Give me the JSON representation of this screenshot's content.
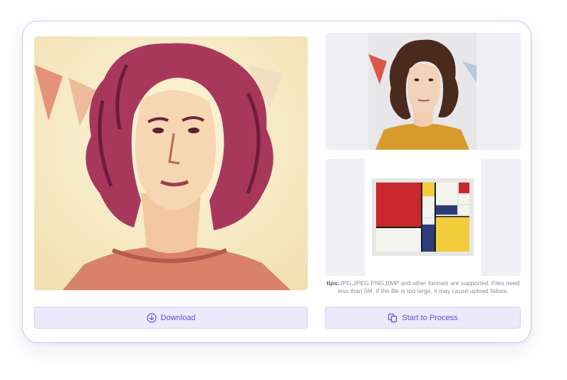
{
  "result": {
    "image_icon": "stylized-portrait-image"
  },
  "original": {
    "image_icon": "portrait-photo"
  },
  "style_reference": {
    "image_icon": "abstract-grid-painting"
  },
  "tips": {
    "label": "tips:",
    "text": "JPG,JPEG,PNG,BMP and other formats are supported. Files need less than 5M. If the file is too large, it may cause upload failure."
  },
  "actions": {
    "download_label": "Download",
    "download_icon": "download-circle-icon",
    "process_label": "Start to Process",
    "process_icon": "copy-process-icon"
  },
  "colors": {
    "accent": "#5b4fd6",
    "button_bg": "#ece9fb",
    "card_border": "#cbc5ef",
    "panel_bg": "#efeff4"
  }
}
